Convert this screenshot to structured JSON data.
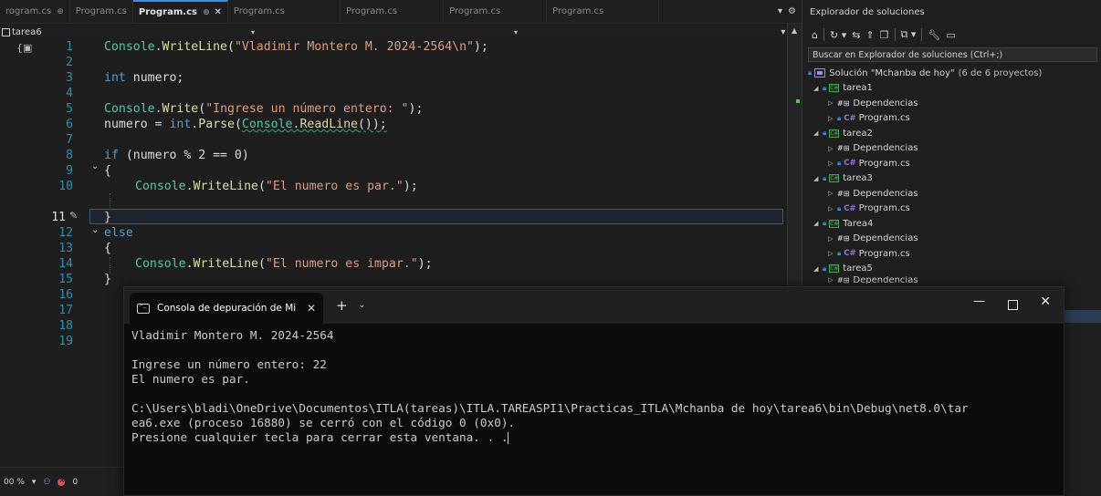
{
  "tabs": [
    {
      "label": "rogram.cs",
      "pin": "⊕",
      "active": false
    },
    {
      "label": "Program.cs",
      "active": false
    },
    {
      "label": "Program.cs",
      "active": true
    },
    {
      "label": "Program.cs",
      "active": false
    },
    {
      "label": "Program.cs",
      "active": false
    },
    {
      "label": "Program.cs",
      "active": false
    },
    {
      "label": "Program.cs",
      "active": false
    }
  ],
  "active_tab": {
    "label": "Program.cs",
    "pin": "⊕",
    "close": "✕"
  },
  "navbar": {
    "project": "tarea6"
  },
  "editor": {
    "line_numbers": [
      "1",
      "2",
      "3",
      "4",
      "5",
      "6",
      "7",
      "8",
      "9",
      "10",
      "11",
      "12",
      "13",
      "14",
      "15",
      "16",
      "17",
      "18",
      "19"
    ],
    "current_line": "11"
  },
  "status": {
    "zoom": "00 %",
    "errors": "0"
  },
  "solution_explorer": {
    "title": "Explorador de soluciones",
    "search_placeholder": "Buscar en Explorador de soluciones (Ctrl+;)",
    "solution_label": "Solución \"Mchanba de hoy\"",
    "solution_count": "(6 de 6 proyectos)",
    "projects": [
      {
        "name": "tarea1",
        "dependencies": "Dependencias",
        "file": "Program.cs"
      },
      {
        "name": "tarea2",
        "dependencies": "Dependencias",
        "file": "Program.cs"
      },
      {
        "name": "tarea3",
        "dependencies": "Dependencias",
        "file": "Program.cs"
      },
      {
        "name": "Tarea4",
        "dependencies": "Dependencias",
        "file": "Program.cs"
      },
      {
        "name": "tarea5",
        "dependencies": "Dependencias"
      }
    ]
  },
  "console": {
    "tab_title": "Consola de depuración de Mi",
    "lines": [
      "Vladimir Montero M. 2024-2564",
      "",
      "Ingrese un número entero: 22",
      "El numero es par.",
      "",
      "C:\\Users\\bladi\\OneDrive\\Documentos\\ITLA(tareas)\\ITLA.TAREASPI1\\Practicas_ITLA\\Mchanba de hoy\\tarea6\\bin\\Debug\\net8.0\\tar",
      "ea6.exe (proceso 16880) se cerró con el código 0 (0x0).",
      "Presione cualquier tecla para cerrar esta ventana. . ."
    ]
  },
  "code": {
    "l1": {
      "obj": "Console",
      "dot": ".",
      "method": "WriteLine",
      "open": "(",
      "str": "\"Vladimir Montero M. 2024-2564\\n\"",
      "close": ");"
    },
    "l3": {
      "kw": "int",
      "rest": " numero;"
    },
    "l5": {
      "obj": "Console",
      "dot": ".",
      "method": "Write",
      "open": "(",
      "str": "\"Ingrese un número entero: \"",
      "close": ");"
    },
    "l6": {
      "a": "numero = ",
      "kw": "int",
      "dot": ".",
      "m1": "Parse",
      "open": "(",
      "obj": "Console",
      "dot2": ".",
      "m2": "ReadLine",
      "close": "());"
    },
    "l8": {
      "kw": "if",
      "rest": " (numero % 2 == 0)"
    },
    "l9": {
      "text": "{"
    },
    "l10": {
      "obj": "Console",
      "dot": ".",
      "method": "WriteLine",
      "open": "(",
      "str": "\"El numero es par.\"",
      "close": ");"
    },
    "l11": {
      "text": "}"
    },
    "l12": {
      "kw": "else"
    },
    "l13": {
      "text": "{"
    },
    "l14": {
      "obj": "Console",
      "dot": ".",
      "method": "WriteLine",
      "open": "(",
      "str": "\"El numero es impar.\"",
      "close": ");"
    },
    "l15": {
      "text": "}"
    }
  }
}
